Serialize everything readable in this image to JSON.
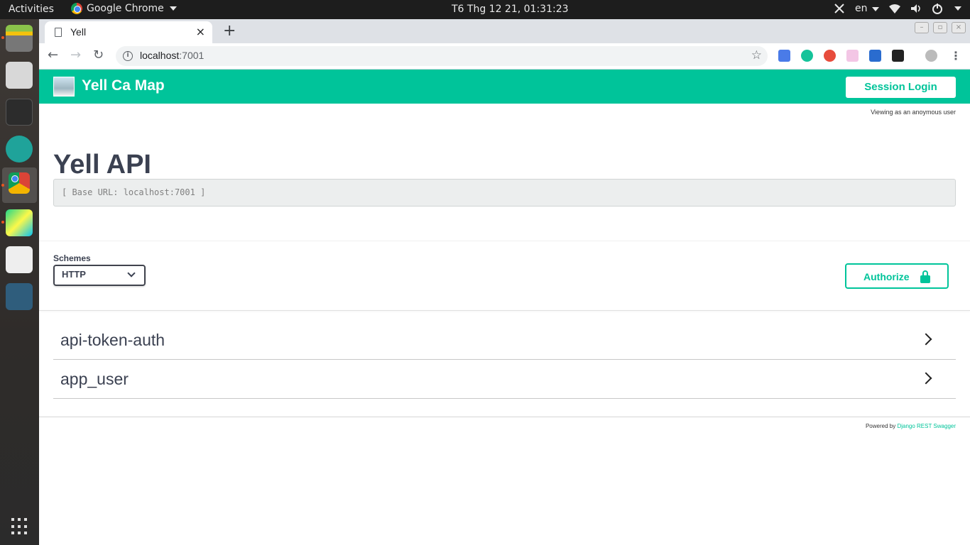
{
  "desktop": {
    "activities": "Activities",
    "app_name": "Google Chrome",
    "clock": "T6 Thg 12 21, 01:31:23",
    "lang": "en"
  },
  "browser": {
    "tab_title": "Yell",
    "url_host": "localhost",
    "url_port": ":7001",
    "new_tab": "+",
    "tab_close": "×"
  },
  "page": {
    "brand": "Yell Ca Map",
    "session_login": "Session Login",
    "anon_notice": "Viewing as an anoymous user",
    "api_title": "Yell API",
    "base_url": "[ Base URL: localhost:7001 ]",
    "schemes_label": "Schemes",
    "scheme_selected": "HTTP",
    "authorize_label": "Authorize",
    "tags": [
      "api-token-auth",
      "app_user"
    ],
    "powered_prefix": "Powered by",
    "powered_link": "Django REST Swagger"
  },
  "colors": {
    "accent": "#00c49a",
    "title": "#3b4151"
  }
}
